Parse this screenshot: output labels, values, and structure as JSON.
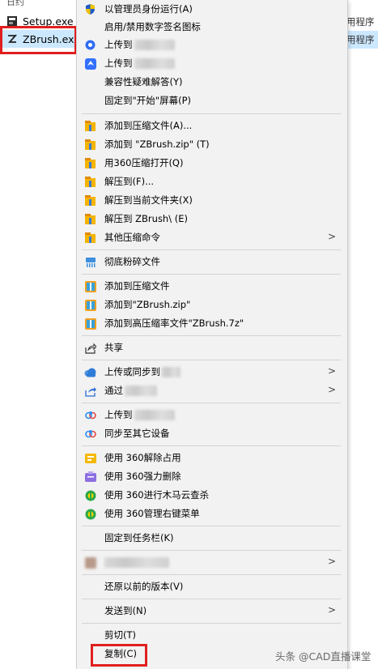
{
  "explorer": {
    "top_cut_text": "日约",
    "files": [
      {
        "name": "Setup.exe",
        "type": "用程序",
        "icon": "setup-exe-icon"
      },
      {
        "name": "ZBrush.exe",
        "type": "用程序",
        "icon": "zbrush-icon"
      }
    ]
  },
  "menu": {
    "items": [
      {
        "key": "run_as_admin",
        "label": "以管理员身份运行(A)",
        "icon": "uac-shield-icon"
      },
      {
        "key": "signature_icon",
        "label": "启用/禁用数字签名图标",
        "icon": "none"
      },
      {
        "key": "upload_to_1",
        "label": "上传到",
        "icon": "upload-circle-icon"
      },
      {
        "key": "upload_to_2",
        "label": "上传到",
        "icon": "feishu-icon"
      },
      {
        "key": "compat_troubleshoot",
        "label": "兼容性疑难解答(Y)",
        "icon": "none"
      },
      {
        "key": "pin_to_start",
        "label": "固定到\"开始\"屏幕(P)",
        "icon": "none"
      },
      {
        "key": "add_archive",
        "label": "添加到压缩文件(A)...",
        "icon": "archive-icon"
      },
      {
        "key": "add_zip",
        "label": "添加到 \"ZBrush.zip\" (T)",
        "icon": "archive-icon"
      },
      {
        "key": "open_360zip",
        "label": "用360压缩打开(Q)",
        "icon": "archive-icon"
      },
      {
        "key": "extract_to",
        "label": "解压到(F)...",
        "icon": "archive-icon"
      },
      {
        "key": "extract_here",
        "label": "解压到当前文件夹(X)",
        "icon": "archive-icon"
      },
      {
        "key": "extract_zbrush",
        "label": "解压到 ZBrush\\ (E)",
        "icon": "archive-icon"
      },
      {
        "key": "other_zip_cmds",
        "label": "其他压缩命令",
        "icon": "archive-icon"
      },
      {
        "key": "shred",
        "label": "彻底粉碎文件",
        "icon": "shredder-icon"
      },
      {
        "key": "add_archive_2",
        "label": "添加到压缩文件",
        "icon": "winrar-icon"
      },
      {
        "key": "add_zip_2",
        "label": "添加到\"ZBrush.zip\"",
        "icon": "winrar-icon"
      },
      {
        "key": "add_7z",
        "label": "添加到高压缩率文件\"ZBrush.7z\"",
        "icon": "winrar-icon"
      },
      {
        "key": "share",
        "label": "共享",
        "icon": "share-icon"
      },
      {
        "key": "upload_or_sync",
        "label": "上传或同步到",
        "icon": "cloud-icon"
      },
      {
        "key": "via",
        "label": "通过",
        "icon": "share-via-icon"
      },
      {
        "key": "upload_to_3",
        "label": "上传到",
        "icon": "baidu-cloud-icon"
      },
      {
        "key": "sync_other_devices",
        "label": "同步至其它设备",
        "icon": "baidu-cloud-icon"
      },
      {
        "key": "360_unlock",
        "label": "使用 360解除占用",
        "icon": "360-unlock-icon"
      },
      {
        "key": "360_force_delete",
        "label": "使用 360强力删除",
        "icon": "360-delete-icon"
      },
      {
        "key": "360_trojan_scan",
        "label": "使用 360进行木马云查杀",
        "icon": "360-guard-icon"
      },
      {
        "key": "360_manage_menu",
        "label": "使用 360管理右键菜单",
        "icon": "360-guard-icon"
      },
      {
        "key": "pin_taskbar",
        "label": "固定到任务栏(K)",
        "icon": "none"
      },
      {
        "key": "blurred_item",
        "label": "",
        "icon": "blurred-icon"
      },
      {
        "key": "restore_prev",
        "label": "还原以前的版本(V)",
        "icon": "none"
      },
      {
        "key": "send_to",
        "label": "发送到(N)",
        "icon": "none"
      },
      {
        "key": "cut",
        "label": "剪切(T)",
        "icon": "none"
      },
      {
        "key": "copy",
        "label": "复制(C)",
        "icon": "none"
      }
    ]
  },
  "watermark": "头条 @CAD直播课堂",
  "colors": {
    "highlight_red": "#e02020",
    "selection_blue": "#cce8ff",
    "menu_bg": "#f2f2f2"
  }
}
